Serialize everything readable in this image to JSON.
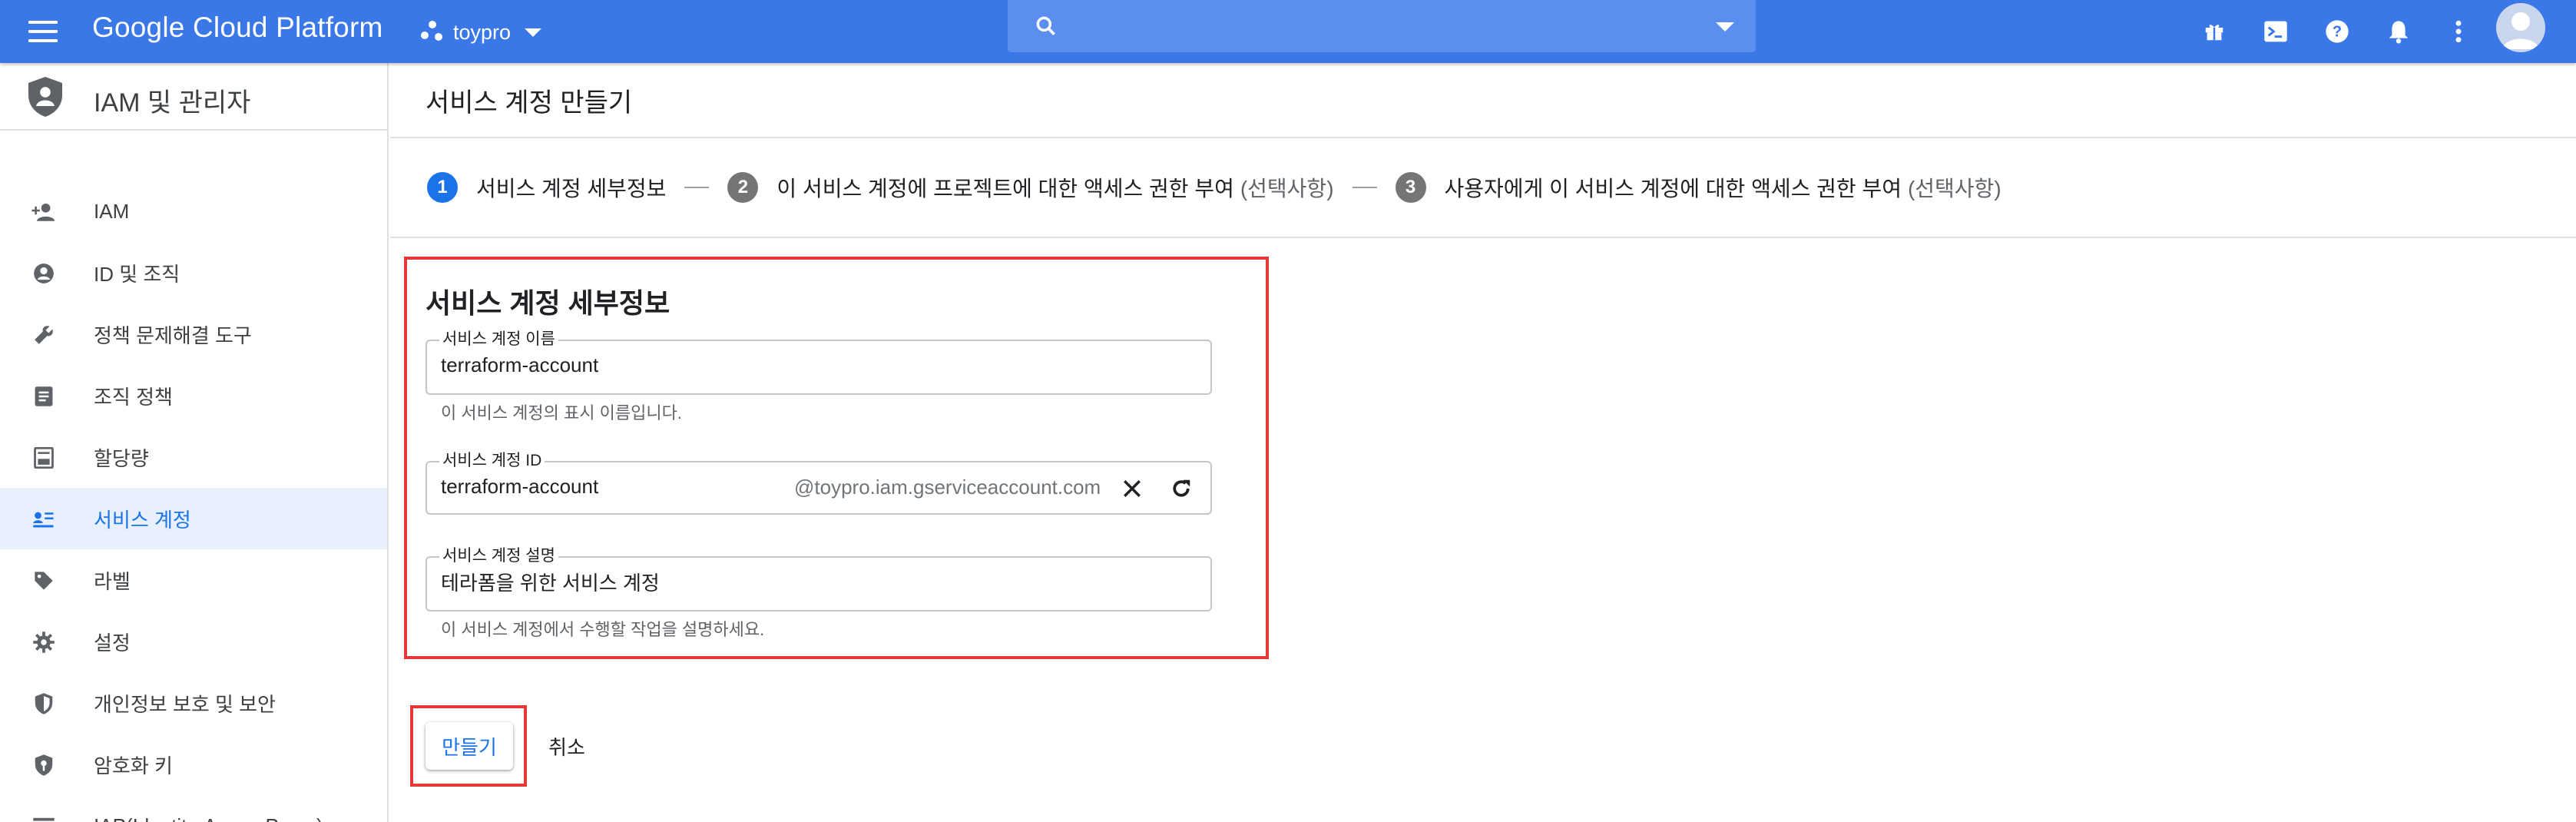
{
  "topbar": {
    "brand": "Google Cloud Platform",
    "project": "toypro",
    "search_placeholder": "",
    "icons": [
      "gift-icon",
      "cloud-shell-icon",
      "help-icon",
      "notifications-icon",
      "more-vert-icon",
      "account-avatar"
    ]
  },
  "sidebar": {
    "title": "IAM 및 관리자",
    "items": [
      {
        "label": "IAM",
        "icon": "person-add-icon"
      },
      {
        "label": "ID 및 조직",
        "icon": "account-circle-icon"
      },
      {
        "label": "정책 문제해결 도구",
        "icon": "wrench-icon"
      },
      {
        "label": "조직 정책",
        "icon": "list-doc-icon"
      },
      {
        "label": "할당량",
        "icon": "quota-icon"
      },
      {
        "label": "서비스 계정",
        "icon": "service-account-icon",
        "active": true
      },
      {
        "label": "라벨",
        "icon": "label-icon"
      },
      {
        "label": "설정",
        "icon": "gear-icon"
      },
      {
        "label": "개인정보 보호 및 보안",
        "icon": "privacy-shield-icon"
      },
      {
        "label": "암호화 키",
        "icon": "key-shield-icon"
      },
      {
        "label": "IAP(Identity-Aware Proxy)",
        "icon": "iap-icon"
      }
    ]
  },
  "main": {
    "page_title": "서비스 계정 만들기",
    "steps": [
      {
        "number": "1",
        "label": "서비스 계정 세부정보",
        "optional": ""
      },
      {
        "number": "2",
        "label": "이 서비스 계정에 프로젝트에 대한 액세스 권한 부여",
        "optional": "(선택사항)"
      },
      {
        "number": "3",
        "label": "사용자에게 이 서비스 계정에 대한 액세스 권한 부여",
        "optional": "(선택사항)"
      }
    ],
    "section_title": "서비스 계정 세부정보",
    "fields": {
      "name": {
        "label": "서비스 계정 이름",
        "value": "terraform-account",
        "hint": "이 서비스 계정의 표시 이름입니다."
      },
      "id": {
        "label": "서비스 계정 ID",
        "value": "terraform-account",
        "suffix": "@toypro.iam.gserviceaccount.com"
      },
      "description": {
        "label": "서비스 계정 설명",
        "value": "테라폼을 위한 서비스 계정",
        "hint": "이 서비스 계정에서 수행할 작업을 설명하세요."
      }
    },
    "buttons": {
      "create": "만들기",
      "cancel": "취소"
    }
  },
  "colors": {
    "topbar": "#3b78e7",
    "accent": "#1a73e8",
    "highlight": "#e53935",
    "active_bg": "#e8f0fe"
  }
}
